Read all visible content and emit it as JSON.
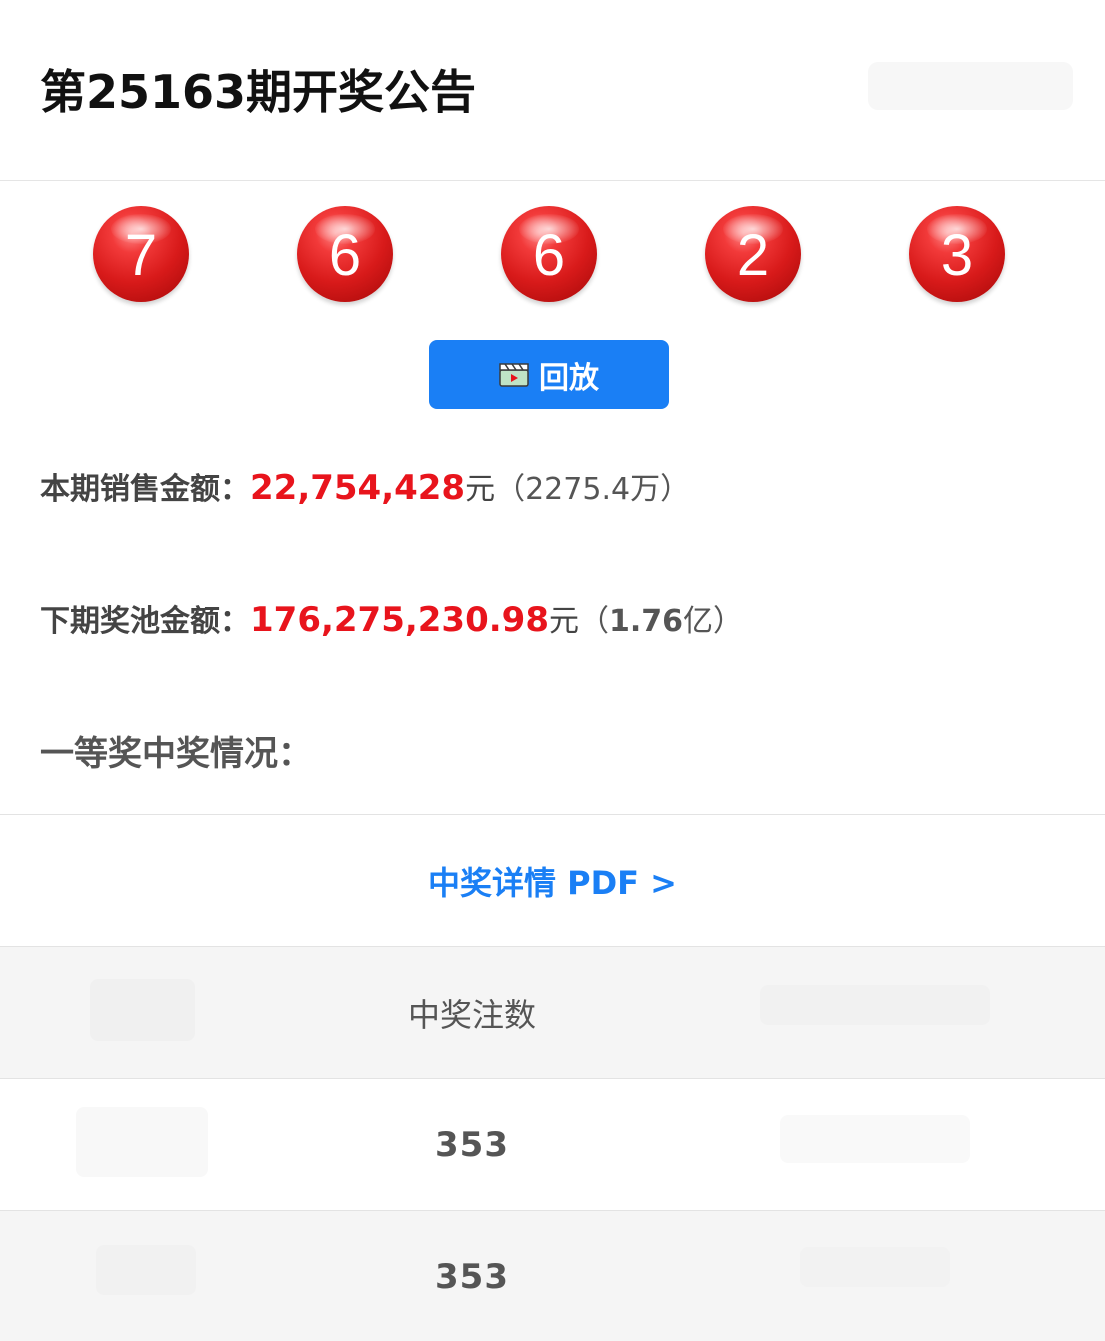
{
  "header": {
    "title": "第25163期开奖公告"
  },
  "draw": {
    "numbers": [
      "7",
      "6",
      "6",
      "2",
      "3"
    ],
    "ball_color": "#d81a1a"
  },
  "replay_button": {
    "label": "回放",
    "icon": "video-clapper-icon",
    "color": "#1a7ff5"
  },
  "sales": {
    "label": "本期销售金额：",
    "amount": "22,754,428",
    "unit": "元",
    "approx": "（2275.4万）"
  },
  "pool": {
    "label": "下期奖池金额：",
    "amount": "176,275,230.98",
    "unit": "元",
    "approx_open": "（",
    "approx_value": "1.76",
    "approx_close": "亿）"
  },
  "first_prize": {
    "title": "一等奖中奖情况："
  },
  "pdf_link": {
    "label": "中奖详情 PDF >"
  },
  "table": {
    "header": "中奖注数",
    "rows": [
      "353",
      "353"
    ]
  },
  "colors": {
    "accent_red": "#e8141c",
    "accent_blue": "#1a7ff5"
  }
}
